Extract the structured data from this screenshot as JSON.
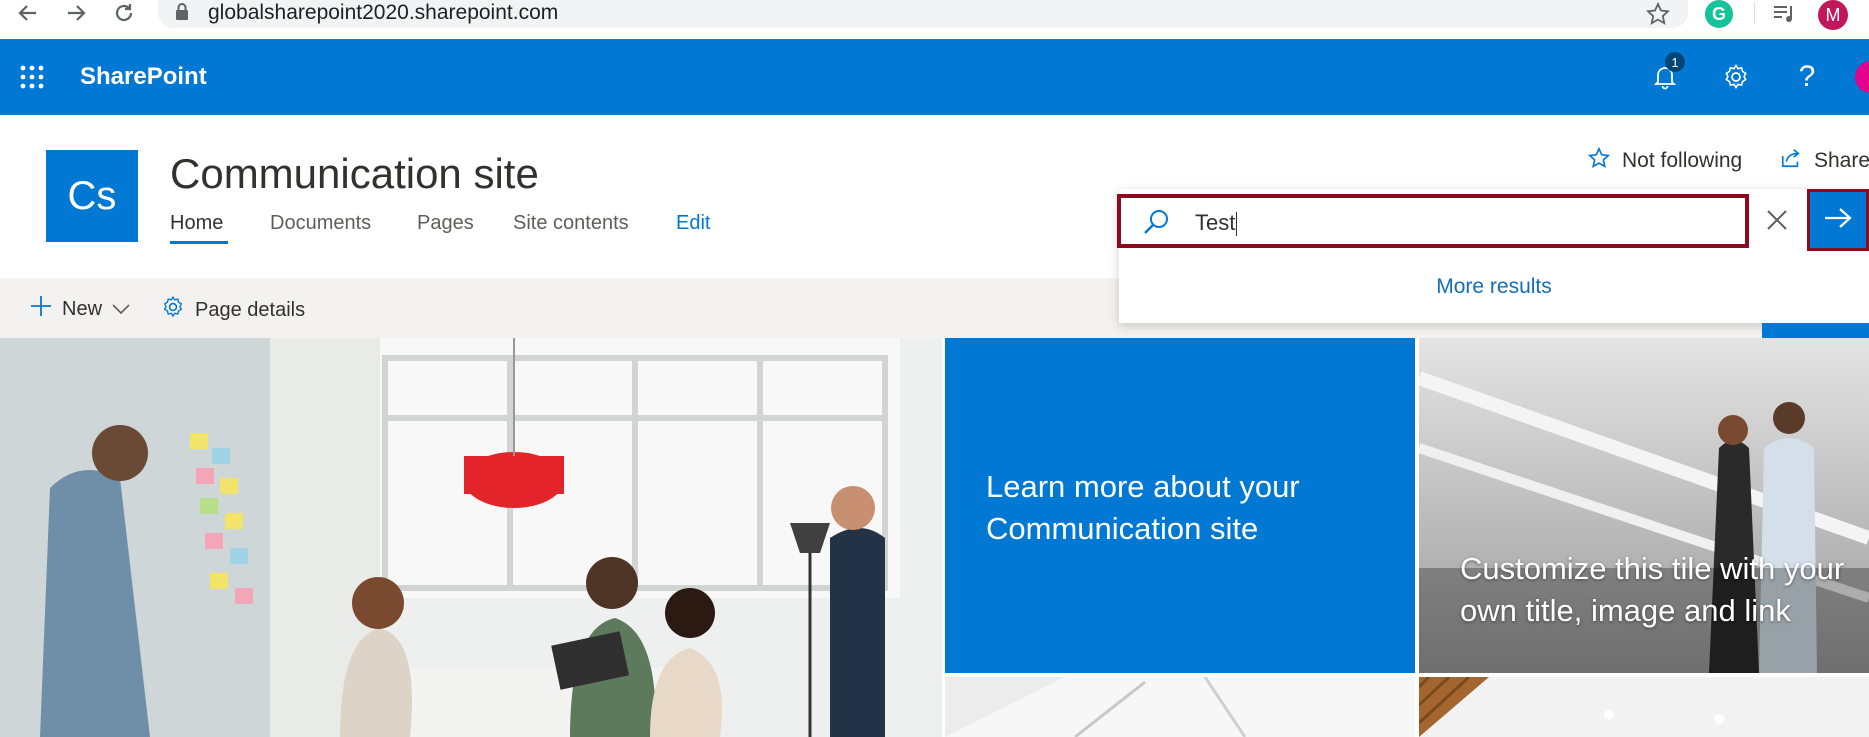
{
  "browser": {
    "url": "globalsharepoint2020.sharepoint.com",
    "profile_initial": "M",
    "icons": [
      "back-icon",
      "forward-icon",
      "reload-icon",
      "lock-icon",
      "star-icon",
      "grammarly-icon",
      "media-icon"
    ]
  },
  "suite_bar": {
    "brand": "SharePoint",
    "notification_count": "1",
    "colors": {
      "bar": "#0078d4"
    }
  },
  "site": {
    "logo_text": "Cs",
    "title": "Communication site",
    "nav": [
      "Home",
      "Documents",
      "Pages",
      "Site contents",
      "Edit"
    ],
    "active_nav": "Home",
    "follow_label": "Not following",
    "share_label": "Share"
  },
  "command_bar": {
    "new_label": "New",
    "page_details_label": "Page details"
  },
  "search": {
    "value": "Test",
    "more_results": "More results",
    "highlight_color": "#8b0a1e"
  },
  "hero": {
    "tile_blue_text": "Learn more about your Communication site",
    "tile_people_text": "Customize this tile with your own title, image and link"
  }
}
